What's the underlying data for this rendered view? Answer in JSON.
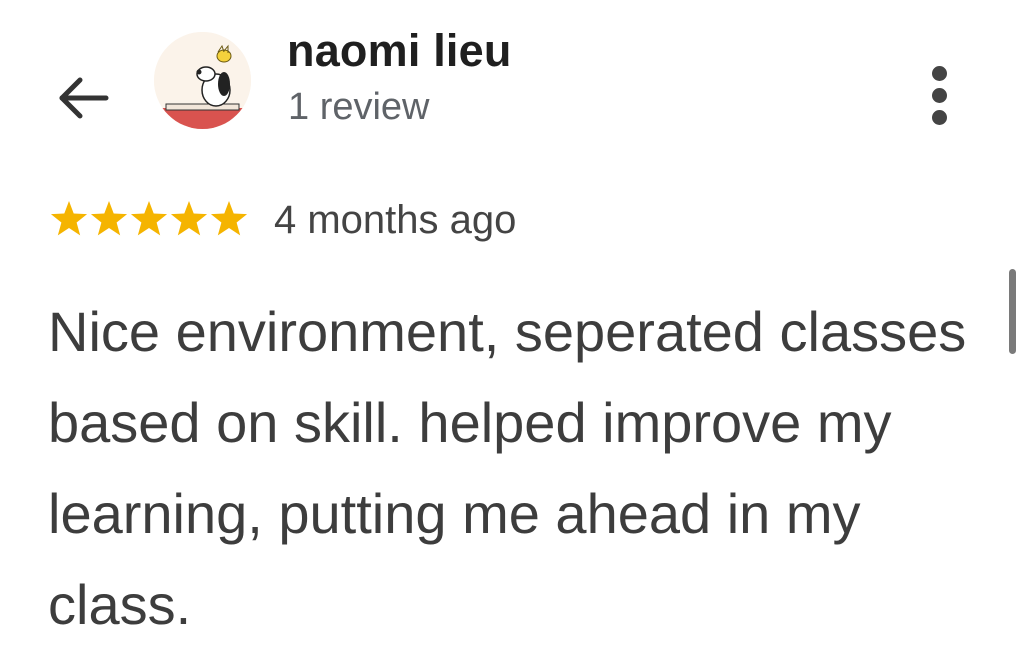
{
  "header": {
    "back_icon": "arrow-left-icon",
    "avatar_icon": "snoopy-avatar",
    "user_name": "naomi lieu",
    "review_count": "1 review",
    "more_icon": "more-vert-icon"
  },
  "review": {
    "rating": 5,
    "rating_max": 5,
    "star_icon": "star-icon",
    "star_color": "#F5B400",
    "date": "4 months ago",
    "text": "Nice environment, seperated classes based on skill. helped improve my learning, putting me ahead in my class."
  },
  "colors": {
    "name_text": "#1f1f1f",
    "meta_text": "#5f6368",
    "body_text": "#3d3d3d",
    "star": "#F5B400"
  }
}
